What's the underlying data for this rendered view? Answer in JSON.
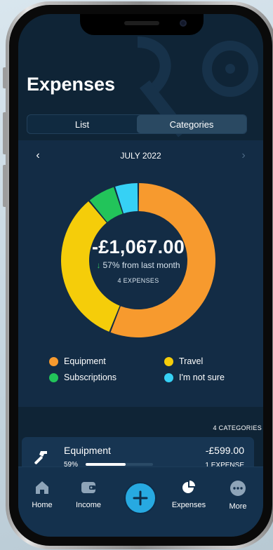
{
  "page": {
    "title": "Expenses"
  },
  "segmented": {
    "tabs": [
      "List",
      "Categories"
    ],
    "active": "Categories"
  },
  "month": {
    "label": "JULY 2022",
    "prev_icon": "chevron-left-icon",
    "next_icon": "chevron-right-icon"
  },
  "summary": {
    "total": "-£1,067.00",
    "trend_arrow": "↓",
    "trend_text": "57% from last month",
    "expense_count": "4 EXPENSES"
  },
  "chart_data": {
    "type": "pie",
    "categories": [
      "Equipment",
      "Travel",
      "Subscriptions",
      "I'm not sure"
    ],
    "values": [
      56,
      33,
      6,
      5
    ],
    "colors": [
      "#f79a2e",
      "#f5cd0a",
      "#22c45a",
      "#36d1f5"
    ]
  },
  "legend": [
    {
      "label": "Equipment",
      "color": "#f79a2e"
    },
    {
      "label": "Travel",
      "color": "#f5cd0a"
    },
    {
      "label": "Subscriptions",
      "color": "#22c45a"
    },
    {
      "label": "I'm not sure",
      "color": "#36d1f5"
    }
  ],
  "categories_list": {
    "count_label": "4 CATEGORIES",
    "items": [
      {
        "name": "Equipment",
        "percent_label": "59%",
        "percent": 59,
        "amount": "-£599.00",
        "expense_count": "1 EXPENSE",
        "icon": "hammer-icon"
      }
    ]
  },
  "tabbar": {
    "home": {
      "label": "Home",
      "icon": "home-icon"
    },
    "income": {
      "label": "Income",
      "icon": "wallet-icon"
    },
    "add": {
      "icon": "plus-icon"
    },
    "expenses": {
      "label": "Expenses",
      "icon": "pie-chart-icon"
    },
    "more": {
      "label": "More",
      "icon": "more-icon"
    }
  },
  "colors": {
    "accent": "#27a9e1",
    "background": "#0f2436",
    "card": "#132c45"
  }
}
